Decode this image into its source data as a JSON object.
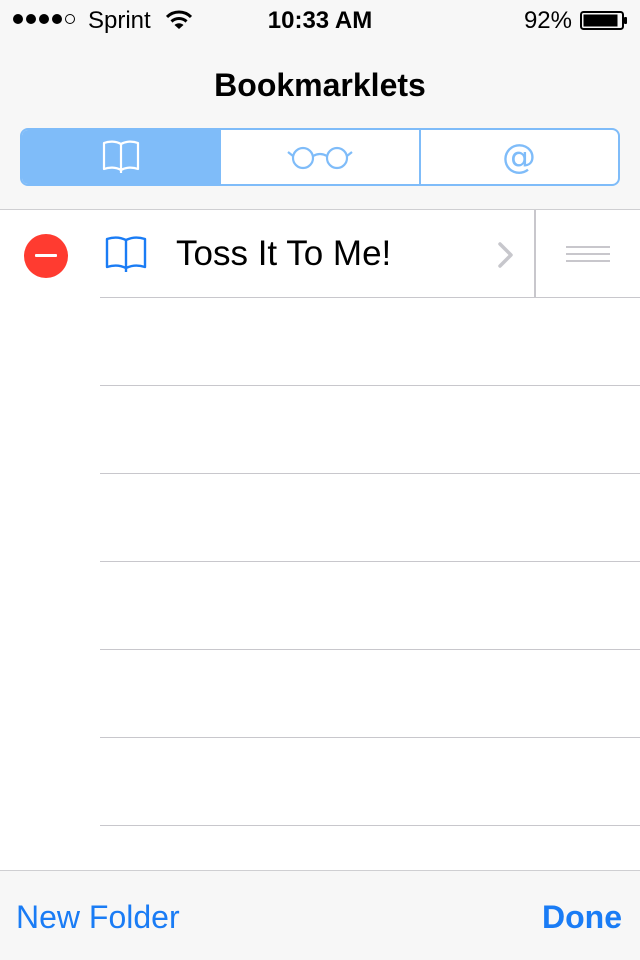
{
  "status_bar": {
    "signal_strength": 4,
    "signal_max": 5,
    "carrier": "Sprint",
    "wifi_icon": "wifi-icon",
    "time": "10:33 AM",
    "battery_percent": "92%",
    "battery_level": 0.92,
    "battery_icon": "battery-icon"
  },
  "nav": {
    "title": "Bookmarklets",
    "segments": [
      {
        "icon": "book-icon",
        "selected": true
      },
      {
        "icon": "glasses-icon",
        "selected": false
      },
      {
        "icon": "at-sign-icon",
        "selected": false
      }
    ]
  },
  "list": {
    "items": [
      {
        "title": "Toss It To Me!",
        "icon": "book-icon",
        "delete_icon": "minus-circle-icon",
        "disclosure_icon": "chevron-right-icon",
        "reorder_icon": "reorder-handle-icon"
      }
    ]
  },
  "toolbar": {
    "new_folder_label": "New Folder",
    "done_label": "Done"
  },
  "colors": {
    "accent": "#1a7cf5",
    "segment_tint": "#7fbcf9",
    "delete_red": "#ff3b30",
    "separator": "#c8c7cc",
    "bar_background": "#f7f7f7"
  }
}
